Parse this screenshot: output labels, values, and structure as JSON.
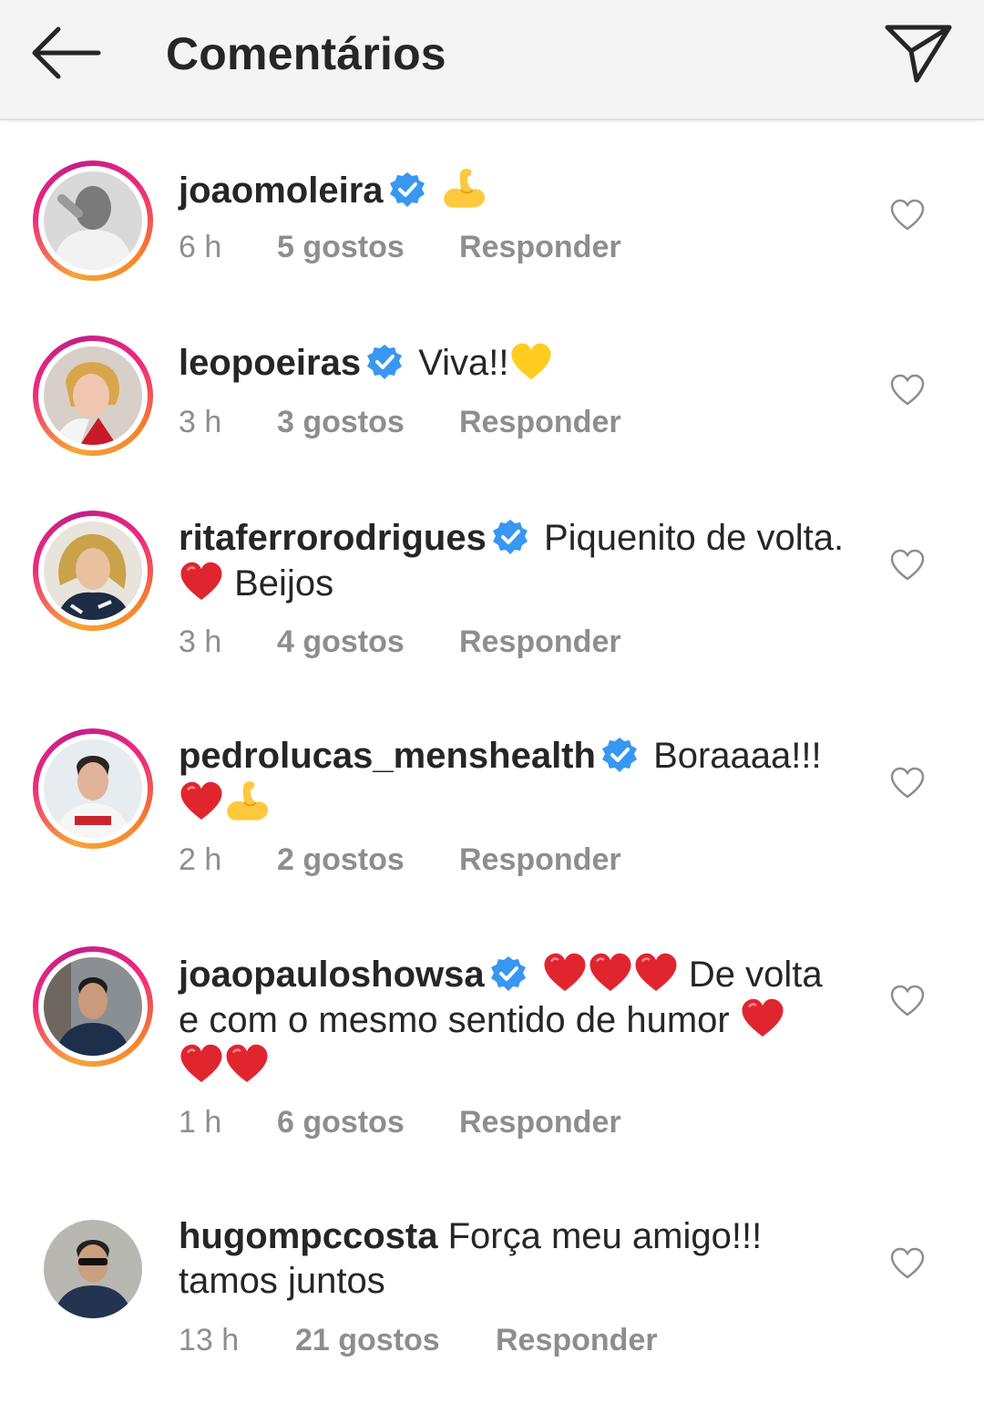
{
  "header": {
    "title": "Comentários",
    "back_icon": "arrow-left-icon",
    "share_icon": "paper-plane-icon"
  },
  "colors": {
    "verified": "#3897f0",
    "meta": "#8e8e8e",
    "text": "#262626",
    "heart": "#e0252f",
    "muscle": "#ffc83d"
  },
  "comments": [
    {
      "username": "joaomoleira",
      "verified": true,
      "text": "",
      "emojis_after": [
        "flexed-biceps"
      ],
      "time": "6 h",
      "likes": "5 gostos",
      "reply": "Responder"
    },
    {
      "username": "leopoeiras",
      "verified": true,
      "text": "Viva!!",
      "emojis_after": [
        "yellow-heart"
      ],
      "time": "3 h",
      "likes": "3 gostos",
      "reply": "Responder"
    },
    {
      "username": "ritaferrorodrigues",
      "verified": true,
      "text_line1": "Piquenito de volta.",
      "text_line2": "Beijos",
      "emojis": [
        "red-heart"
      ],
      "time": "3 h",
      "likes": "4 gostos",
      "reply": "Responder"
    },
    {
      "username": "pedrolucas_menshealth",
      "verified": true,
      "text": "Boraaaa!!!",
      "emojis": [
        "red-heart",
        "flexed-biceps"
      ],
      "time": "2 h",
      "likes": "2 gostos",
      "reply": "Responder"
    },
    {
      "username": "joaopauloshowsa",
      "verified": true,
      "text_line1": "De volta",
      "text_line2": "e com o mesmo sentido de humor",
      "emojis": [
        "red-heart",
        "red-heart",
        "red-heart",
        "red-heart",
        "red-heart",
        "red-heart"
      ],
      "time": "1 h",
      "likes": "6 gostos",
      "reply": "Responder"
    },
    {
      "username": "hugompccosta",
      "verified": false,
      "text_line1": "Força meu amigo!!!",
      "text_line2": "tamos juntos",
      "time": "13 h",
      "likes": "21 gostos",
      "reply": "Responder"
    }
  ]
}
